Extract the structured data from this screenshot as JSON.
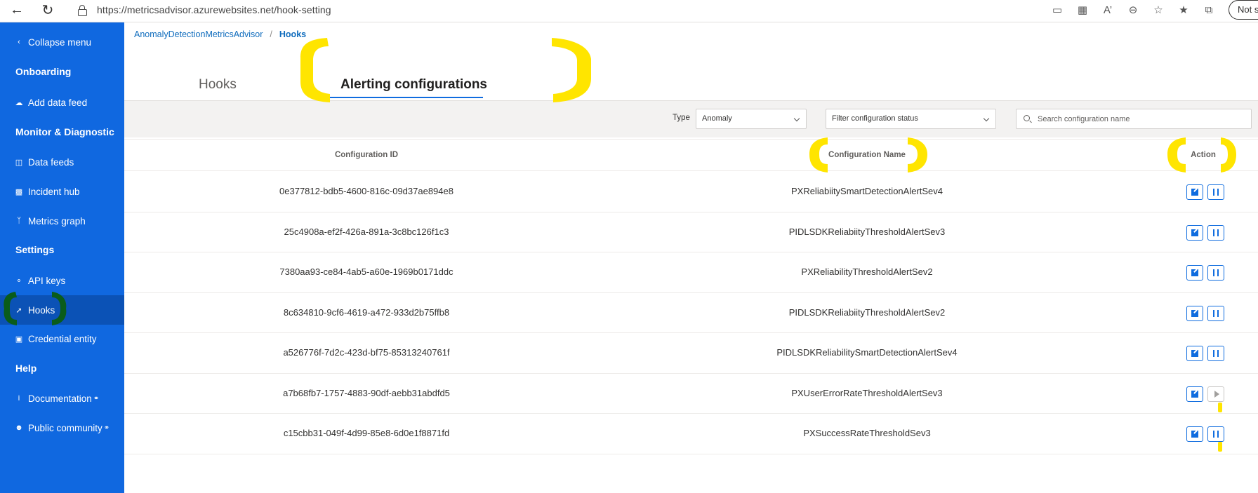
{
  "browser": {
    "url": "https://metricsadvisor.azurewebsites.net/hook-setting",
    "profile_label": "Not s",
    "icons": [
      "back-icon",
      "refresh-icon",
      "lock-icon",
      "app-available-icon",
      "grid-icon",
      "read-aloud-icon",
      "zoom-out-icon",
      "add-favorite-icon",
      "favorites-icon",
      "collections-icon"
    ]
  },
  "sidebar": {
    "collapse": "Collapse menu",
    "sections": {
      "onboarding": "Onboarding",
      "monitor": "Monitor & Diagnostic",
      "settings": "Settings",
      "help": "Help"
    },
    "items": {
      "add_data_feed": "Add data feed",
      "data_feeds": "Data feeds",
      "incident_hub": "Incident hub",
      "metrics_graph": "Metrics graph",
      "api_keys": "API keys",
      "hooks": "Hooks",
      "credential_entity": "Credential entity",
      "documentation": "Documentation",
      "public_community": "Public community"
    }
  },
  "breadcrumb": {
    "root": "AnomalyDetectionMetricsAdvisor",
    "separator": "/",
    "current": "Hooks"
  },
  "tabs": {
    "hooks": "Hooks",
    "alerting": "Alerting configurations",
    "active": "alerting"
  },
  "filters": {
    "type_label": "Type",
    "type_value": "Anomaly",
    "status_placeholder": "Filter configuration status",
    "search_placeholder": "Search configuration name"
  },
  "table": {
    "headers": {
      "id": "Configuration ID",
      "name": "Configuration Name",
      "action": "Action"
    },
    "rows": [
      {
        "id": "0e377812-bdb5-4600-816c-09d37ae894e8",
        "name": "PXReliabiitySmartDetectionAlertSev4",
        "state": "active"
      },
      {
        "id": "25c4908a-ef2f-426a-891a-3c8bc126f1c3",
        "name": "PIDLSDKReliabiityThresholdAlertSev3",
        "state": "active"
      },
      {
        "id": "7380aa93-ce84-4ab5-a60e-1969b0171ddc",
        "name": "PXReliabilityThresholdAlertSev2",
        "state": "active"
      },
      {
        "id": "8c634810-9cf6-4619-a472-933d2b75ffb8",
        "name": "PIDLSDKReliabiityThresholdAlertSev2",
        "state": "active"
      },
      {
        "id": "a526776f-7d2c-423d-bf75-85313240761f",
        "name": "PIDLSDKReliabilitySmartDetectionAlertSev4",
        "state": "active"
      },
      {
        "id": "a7b68fb7-1757-4883-90df-aebb31abdfd5",
        "name": "PXUserErrorRateThresholdAlertSev3",
        "state": "paused"
      },
      {
        "id": "c15cbb31-049f-4d99-85e8-6d0e1f8871fd",
        "name": "PXSuccessRateThresholdSev3",
        "state": "active"
      }
    ]
  },
  "colors": {
    "sidebar": "#1068e0",
    "accent": "#0f6cdf",
    "highlight_yellow": "#ffe500",
    "highlight_green": "#0a5c1a"
  }
}
